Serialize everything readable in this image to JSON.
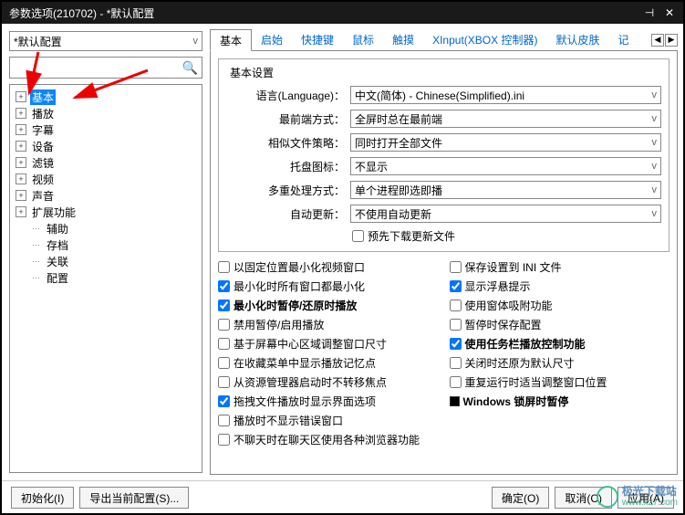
{
  "window": {
    "title": "参数选项(210702) - *默认配置"
  },
  "profile": {
    "current": "*默认配置"
  },
  "tree": {
    "main": [
      {
        "label": "基本",
        "selected": true,
        "expand": true
      },
      {
        "label": "播放",
        "expand": true
      },
      {
        "label": "字幕",
        "expand": true
      },
      {
        "label": "设备",
        "expand": true
      },
      {
        "label": "滤镜",
        "expand": true
      },
      {
        "label": "视频",
        "expand": true
      },
      {
        "label": "声音",
        "expand": true
      },
      {
        "label": "扩展功能",
        "expand": true
      }
    ],
    "sub": [
      {
        "label": "辅助"
      },
      {
        "label": "存档"
      },
      {
        "label": "关联"
      },
      {
        "label": "配置"
      }
    ]
  },
  "tabs": {
    "items": [
      {
        "label": "基本",
        "active": true
      },
      {
        "label": "启始"
      },
      {
        "label": "快捷键"
      },
      {
        "label": "鼠标"
      },
      {
        "label": "触摸"
      },
      {
        "label": "XInput(XBOX 控制器)"
      },
      {
        "label": "默认皮肤"
      },
      {
        "label": "记"
      }
    ]
  },
  "settings": {
    "legend": "基本设置",
    "language_label": "语言(Language)：",
    "language_value": "中文(简体) - Chinese(Simplified).ini",
    "front_label": "最前端方式：",
    "front_value": "全屏时总在最前端",
    "similar_label": "相似文件策略：",
    "similar_value": "同时打开全部文件",
    "tray_label": "托盘图标：",
    "tray_value": "不显示",
    "multi_label": "多重处理方式：",
    "multi_value": "单个进程即选即播",
    "update_label": "自动更新：",
    "update_value": "不使用自动更新",
    "predownload": "预先下载更新文件"
  },
  "checks_left": [
    {
      "label": "以固定位置最小化视频窗口",
      "checked": false
    },
    {
      "label": "最小化时所有窗口都最小化",
      "checked": true
    },
    {
      "label": "最小化时暂停/还原时播放",
      "checked": true,
      "bold": true
    },
    {
      "label": "禁用暂停/启用播放",
      "checked": false
    },
    {
      "label": "基于屏幕中心区域调整窗口尺寸",
      "checked": false
    },
    {
      "label": "在收藏菜单中显示播放记忆点",
      "checked": false
    },
    {
      "label": "从资源管理器启动时不转移焦点",
      "checked": false
    },
    {
      "label": "拖拽文件播放时显示界面选项",
      "checked": true
    },
    {
      "label": "播放时不显示错误窗口",
      "checked": false
    },
    {
      "label": "不聊天时在聊天区使用各种浏览器功能",
      "checked": false
    }
  ],
  "checks_right": [
    {
      "label": "保存设置到 INI 文件",
      "checked": false
    },
    {
      "label": "显示浮悬提示",
      "checked": true
    },
    {
      "label": "使用窗体吸附功能",
      "checked": false
    },
    {
      "label": "暂停时保存配置",
      "checked": false
    },
    {
      "label": "使用任务栏播放控制功能",
      "checked": true,
      "bold": true
    },
    {
      "label": "关闭时还原为默认尺寸",
      "checked": false
    },
    {
      "label": "重复运行时适当调整窗口位置",
      "checked": false
    },
    {
      "label": "Windows 锁屏时暂停",
      "filled": true,
      "bold": true
    }
  ],
  "footer": {
    "init": "初始化(I)",
    "export": "导出当前配置(S)...",
    "ok": "确定(O)",
    "cancel": "取消(C)",
    "apply": "应用(A)"
  },
  "watermark": {
    "text": "极光下载站",
    "url": "www.xz7.com"
  }
}
